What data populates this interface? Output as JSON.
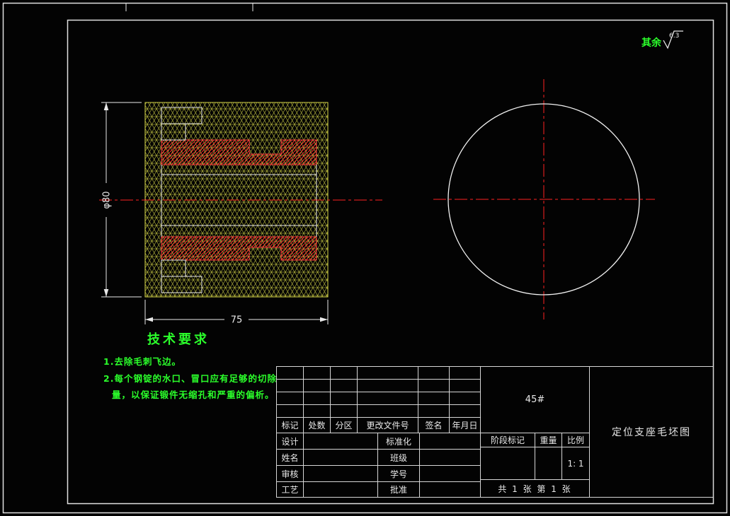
{
  "colors": {
    "accent_green": "#2bff2b",
    "centerline_red": "#ff2020",
    "hatch_yellow": "#d8d848",
    "line_white": "#f0f0f0"
  },
  "surface_note": {
    "label": "其余",
    "roughness_value": "6.3"
  },
  "dimensions": {
    "diameter": "φ80",
    "width": "75"
  },
  "tech_requirements": {
    "title": "技术要求",
    "line1": "1.去除毛刺飞边。",
    "line2": "2.每个钢锭的水口、冒口应有足够的切除",
    "line3": "量，以保证锻件无缩孔和严重的偏析。"
  },
  "title_block": {
    "revision_header": {
      "mark": "标记",
      "count": "处数",
      "zone": "分区",
      "doc_no": "更改文件号",
      "sign": "签名",
      "date": "年月日"
    },
    "rows": [
      {
        "l1": "设计",
        "l2": "标准化"
      },
      {
        "l1": "姓名",
        "l2": "班级"
      },
      {
        "l1": "审核",
        "l2": "学号"
      },
      {
        "l1": "工艺",
        "l2": "批准"
      }
    ],
    "material": "45#",
    "stage_mark": "阶段标记",
    "weight": "重量",
    "scale": "比例",
    "scale_value": "1: 1",
    "sheet_info": "共 1 张 第 1 张",
    "drawing_title": "定位支座毛坯图"
  }
}
